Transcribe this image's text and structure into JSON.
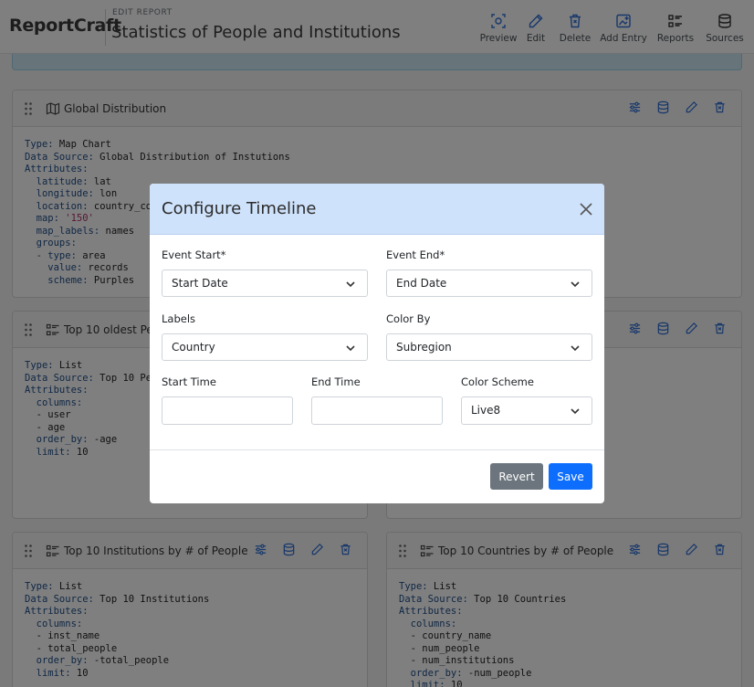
{
  "header": {
    "brand": "ReportCraft",
    "edit_label": "EDIT REPORT",
    "title": "Statistics of People and Institutions",
    "toolbar": [
      {
        "label": "Preview",
        "icon": "preview-icon"
      },
      {
        "label": "Edit",
        "icon": "pencil-icon"
      },
      {
        "label": "Delete",
        "icon": "trash-icon"
      },
      {
        "label": "Add Entry",
        "icon": "add-entry-icon"
      },
      {
        "label": "Reports",
        "icon": "list-icon"
      },
      {
        "label": "Sources",
        "icon": "database-icon"
      }
    ]
  },
  "cards": [
    {
      "title": "Global Distribution",
      "icon": "map-icon",
      "lines": [
        {
          "k": "Type:",
          "v": " Map Chart"
        },
        {
          "k": "Data Source:",
          "v": " Global Distribution of Instutions"
        },
        {
          "k": "Attributes:",
          "v": ""
        },
        {
          "k": "  latitude:",
          "v": " lat"
        },
        {
          "k": "  longitude:",
          "v": " lon"
        },
        {
          "k": "  location:",
          "v": " country_code"
        },
        {
          "k": "  map:",
          "v": " ",
          "s": "'150'"
        },
        {
          "k": "  map_labels:",
          "v": " names"
        },
        {
          "k": "  groups:",
          "v": ""
        },
        {
          "k": "  - type:",
          "v": " area"
        },
        {
          "k": "    value:",
          "v": " records"
        },
        {
          "k": "    scheme:",
          "v": " Purples"
        }
      ]
    },
    {
      "title": "Top 10 oldest People",
      "icon": "list-icon",
      "lines": [
        {
          "k": "Type:",
          "v": " List"
        },
        {
          "k": "Data Source:",
          "v": " Top 10 People"
        },
        {
          "k": "Attributes:",
          "v": ""
        },
        {
          "k": "  columns:",
          "v": ""
        },
        {
          "k": "",
          "v": "  - user"
        },
        {
          "k": "",
          "v": "  - age"
        },
        {
          "k": "  order_by:",
          "v": " -age"
        },
        {
          "k": "  limit:",
          "v": " 10"
        }
      ]
    },
    {
      "title": "",
      "icon": "",
      "lines": []
    },
    {
      "title": "Top 10 Institutions by # of People",
      "icon": "list-icon",
      "lines": [
        {
          "k": "Type:",
          "v": " List"
        },
        {
          "k": "Data Source:",
          "v": " Top 10 Institutions"
        },
        {
          "k": "Attributes:",
          "v": ""
        },
        {
          "k": "  columns:",
          "v": ""
        },
        {
          "k": "",
          "v": "  - inst_name"
        },
        {
          "k": "",
          "v": "  - total_people"
        },
        {
          "k": "  order_by:",
          "v": " -total_people"
        },
        {
          "k": "  limit:",
          "v": " 10"
        }
      ]
    },
    {
      "title": "Top 10 Countries by # of People",
      "icon": "list-icon",
      "lines": [
        {
          "k": "Type:",
          "v": " List"
        },
        {
          "k": "Data Source:",
          "v": " Top 10 Countries"
        },
        {
          "k": "Attributes:",
          "v": ""
        },
        {
          "k": "  columns:",
          "v": ""
        },
        {
          "k": "",
          "v": "  - country_name"
        },
        {
          "k": "",
          "v": "  - num_people"
        },
        {
          "k": "",
          "v": "  - num_institutions"
        },
        {
          "k": "  order_by:",
          "v": " -num_people"
        },
        {
          "k": "  limit:",
          "v": " 10"
        }
      ]
    }
  ],
  "modal": {
    "title": "Configure Timeline",
    "event_start_label": "Event Start*",
    "event_start_value": "Start Date",
    "event_end_label": "Event End*",
    "event_end_value": "End Date",
    "labels_label": "Labels",
    "labels_value": "Country",
    "color_by_label": "Color By",
    "color_by_value": "Subregion",
    "start_time_label": "Start Time",
    "start_time_value": "",
    "end_time_label": "End Time",
    "end_time_value": "",
    "color_scheme_label": "Color Scheme",
    "color_scheme_value": "Live8",
    "revert_label": "Revert",
    "save_label": "Save"
  },
  "colors": {
    "accent": "#0d6efd",
    "secondary": "#6c757d",
    "modal_header": "#cfe2fb",
    "icon_blue": "#2f6fd6"
  }
}
